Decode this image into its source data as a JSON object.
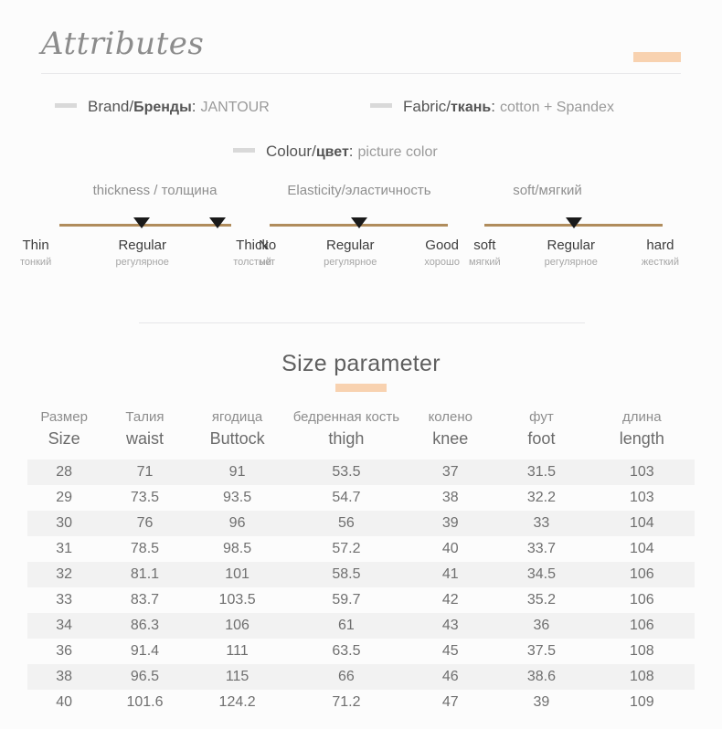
{
  "header": {
    "title": "Attributes",
    "accent_color": "#f8d2b0"
  },
  "specs": {
    "brand": {
      "label_en": "Brand/",
      "label_ru": "Бренды",
      "colon": ":",
      "value": "JANTOUR"
    },
    "fabric": {
      "label_en": "Fabric/",
      "label_ru": "ткань",
      "colon": ":",
      "value": "cotton + Spandex"
    },
    "colour": {
      "label_en": "Colour/",
      "label_ru": "цвет",
      "colon": ":",
      "value": "picture color"
    }
  },
  "sliders": [
    {
      "title": "thickness / толщина",
      "track_color": "#b08c5c",
      "labels": [
        {
          "en": "Thin",
          "ru": "тонкий"
        },
        {
          "en": "Regular",
          "ru": "регулярное"
        },
        {
          "en": "Thick",
          "ru": "толстый"
        }
      ],
      "markers": [
        48,
        92
      ]
    },
    {
      "title": "Elasticity/эластичность",
      "track_color": "#b08c5c",
      "labels": [
        {
          "en": "No",
          "ru": "нет"
        },
        {
          "en": "Regular",
          "ru": "регулярное"
        },
        {
          "en": "Good",
          "ru": "хорошо"
        }
      ],
      "markers": [
        50
      ]
    },
    {
      "title": "soft/мягкий",
      "track_color": "#b08c5c",
      "labels": [
        {
          "en": "soft",
          "ru": "мягкий"
        },
        {
          "en": "Regular",
          "ru": "регулярное"
        },
        {
          "en": "hard",
          "ru": "жесткий"
        }
      ],
      "markers": [
        50
      ]
    }
  ],
  "size_section": {
    "title": "Size parameter",
    "underline_color": "#f8d2b0"
  },
  "chart_data": {
    "type": "table",
    "title": "Size parameter",
    "columns": [
      {
        "ru": "Размер",
        "en": "Size"
      },
      {
        "ru": "Талия",
        "en": "waist"
      },
      {
        "ru": "ягодица",
        "en": "Buttock"
      },
      {
        "ru": "бедренная кость",
        "en": "thigh"
      },
      {
        "ru": "колено",
        "en": "knee"
      },
      {
        "ru": "фут",
        "en": "foot"
      },
      {
        "ru": "длина",
        "en": "length"
      }
    ],
    "rows": [
      [
        "28",
        "71",
        "91",
        "53.5",
        "37",
        "31.5",
        "103"
      ],
      [
        "29",
        "73.5",
        "93.5",
        "54.7",
        "38",
        "32.2",
        "103"
      ],
      [
        "30",
        "76",
        "96",
        "56",
        "39",
        "33",
        "104"
      ],
      [
        "31",
        "78.5",
        "98.5",
        "57.2",
        "40",
        "33.7",
        "104"
      ],
      [
        "32",
        "81.1",
        "101",
        "58.5",
        "41",
        "34.5",
        "106"
      ],
      [
        "33",
        "83.7",
        "103.5",
        "59.7",
        "42",
        "35.2",
        "106"
      ],
      [
        "34",
        "86.3",
        "106",
        "61",
        "43",
        "36",
        "106"
      ],
      [
        "36",
        "91.4",
        "111",
        "63.5",
        "45",
        "37.5",
        "108"
      ],
      [
        "38",
        "96.5",
        "115",
        "66",
        "46",
        "38.6",
        "108"
      ],
      [
        "40",
        "101.6",
        "124.2",
        "71.2",
        "47",
        "39",
        "109"
      ]
    ]
  }
}
